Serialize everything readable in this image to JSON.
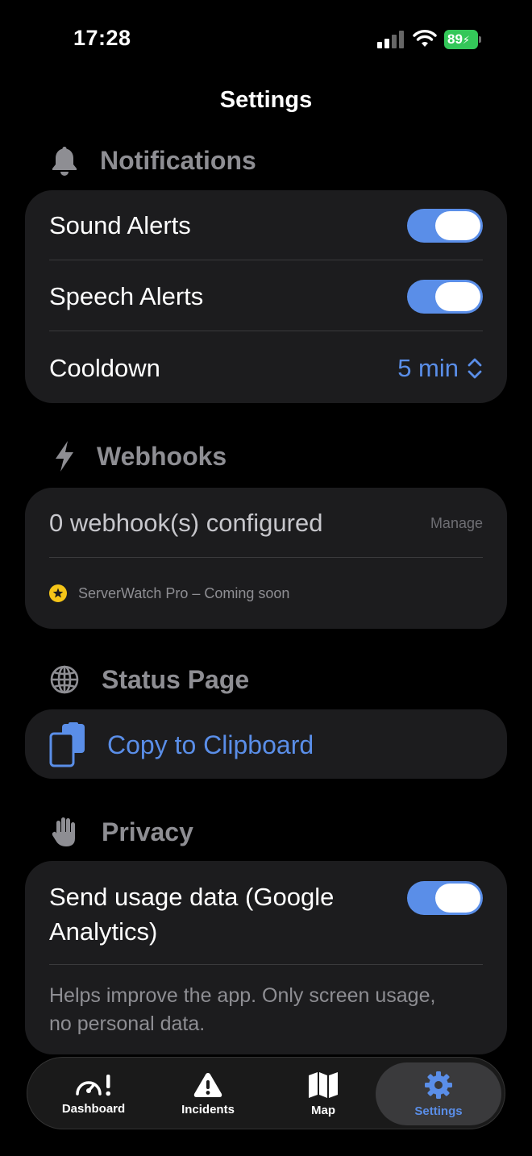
{
  "status_bar": {
    "time": "17:28",
    "battery": "89"
  },
  "page": {
    "title": "Settings"
  },
  "notifications": {
    "header": "Notifications",
    "sound_alerts": {
      "label": "Sound Alerts",
      "on": true
    },
    "speech_alerts": {
      "label": "Speech Alerts",
      "on": true
    },
    "cooldown": {
      "label": "Cooldown",
      "value": "5 min"
    }
  },
  "webhooks": {
    "header": "Webhooks",
    "configured": "0 webhook(s) configured",
    "manage": "Manage",
    "pro_note": "ServerWatch Pro – Coming soon"
  },
  "status_page": {
    "header": "Status Page",
    "copy_label": "Copy to Clipboard"
  },
  "privacy": {
    "header": "Privacy",
    "usage_line1": "Send usage data (Google",
    "usage_line2": "Analytics)",
    "usage_on": true,
    "help_line1": "Helps improve the app. Only screen usage,",
    "help_line2": "no personal data."
  },
  "tabbar": {
    "items": [
      {
        "label": "Dashboard",
        "icon": "speedometer-icon"
      },
      {
        "label": "Incidents",
        "icon": "warning-triangle-icon"
      },
      {
        "label": "Map",
        "icon": "map-icon"
      },
      {
        "label": "Settings",
        "icon": "gear-icon",
        "active": true
      }
    ]
  },
  "colors": {
    "accent": "#5a8ee8",
    "card": "#1c1c1e",
    "muted": "#8e8e93",
    "battery": "#34c759",
    "star": "#f5c518"
  }
}
